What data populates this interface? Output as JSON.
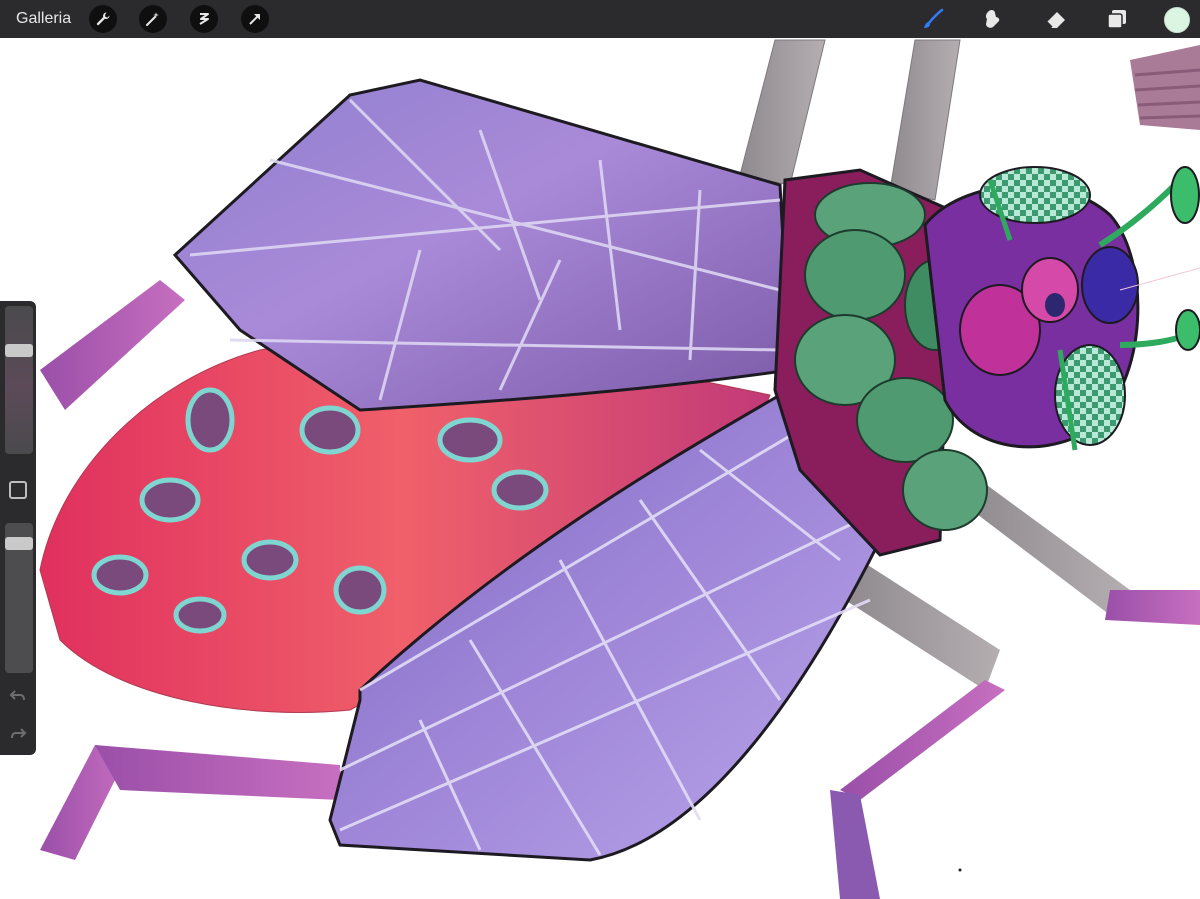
{
  "toolbar": {
    "gallery_label": "Galleria",
    "actions": [
      {
        "icon": "wrench-icon"
      },
      {
        "icon": "magic-wand-icon"
      },
      {
        "icon": "selection-icon"
      },
      {
        "icon": "transform-arrow-icon"
      }
    ],
    "tools": [
      {
        "icon": "brush-icon",
        "active": true,
        "color": "#2f7cf6"
      },
      {
        "icon": "smudge-icon",
        "active": false,
        "color": "#e8e8e8"
      },
      {
        "icon": "eraser-icon",
        "active": false,
        "color": "#e8e8e8"
      },
      {
        "icon": "layers-icon",
        "active": false,
        "color": "#e8e8e8"
      }
    ],
    "current_color": "#dcf5e3"
  },
  "sidebar": {
    "brush_size_level": 0.72,
    "opacity_level": 0.9,
    "modify_icon": "square-icon",
    "undo_icon": "undo-icon",
    "redo_icon": "redo-icon"
  },
  "canvas": {
    "artwork": "insect-illustration",
    "background_color": "#ffffff"
  }
}
